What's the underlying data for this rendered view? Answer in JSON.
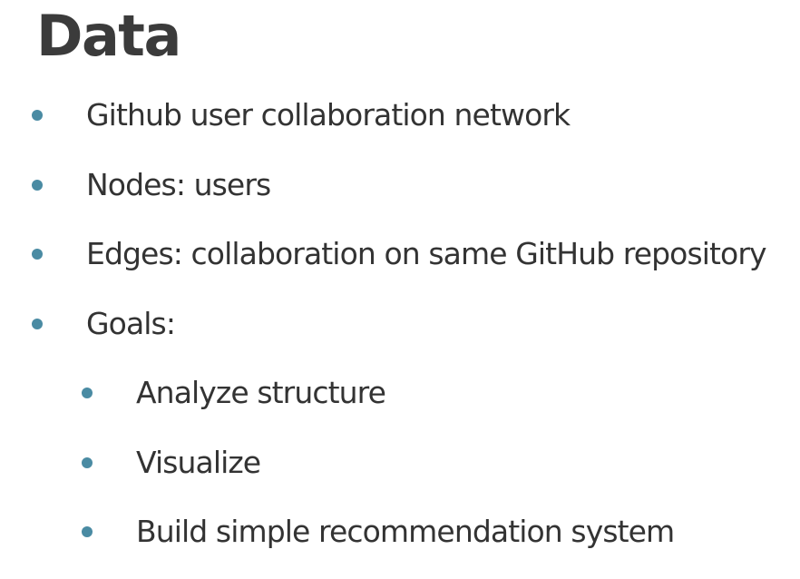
{
  "slide": {
    "title": "Data",
    "bullet_color": "#4a8ba3",
    "bullets": [
      {
        "text": "Github user collaboration network",
        "level": 1
      },
      {
        "text": "Nodes: users",
        "level": 1
      },
      {
        "text": "Edges: collaboration on same GitHub repository",
        "level": 1
      },
      {
        "text": "Goals:",
        "level": 1
      },
      {
        "text": "Analyze structure",
        "level": 2
      },
      {
        "text": "Visualize",
        "level": 2
      },
      {
        "text": "Build simple recommendation system",
        "level": 2
      }
    ]
  }
}
